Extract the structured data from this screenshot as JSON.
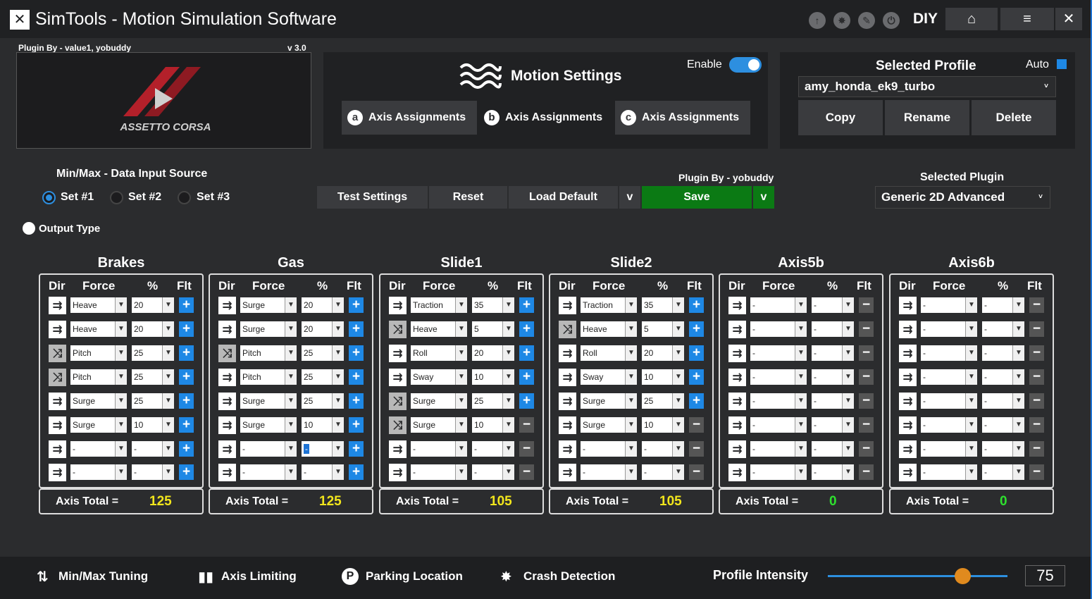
{
  "app": {
    "title": "SimTools - Motion Simulation Software",
    "diy": "DIY"
  },
  "plugin": {
    "by_top": "Plugin By - value1, yobuddy",
    "version": "v 3.0",
    "by_mid": "Plugin By - yobuddy"
  },
  "motion": {
    "title": "Motion Settings",
    "enable_label": "Enable",
    "enabled": true,
    "axis_buttons": [
      {
        "letter": "a",
        "label": "Axis Assignments"
      },
      {
        "letter": "b",
        "label": "Axis Assignments"
      },
      {
        "letter": "c",
        "label": "Axis Assignments"
      }
    ]
  },
  "profile": {
    "title": "Selected Profile",
    "auto_label": "Auto",
    "auto": true,
    "current": "amy_honda_ek9_turbo",
    "buttons": [
      "Copy",
      "Rename",
      "Delete"
    ]
  },
  "minmax": {
    "label": "Min/Max - Data Input Source",
    "sets": [
      "Set #1",
      "Set #2",
      "Set #3"
    ],
    "selected": 0
  },
  "output_type": "Output Type",
  "actions": {
    "test": "Test Settings",
    "reset": "Reset",
    "load_default": "Load Default",
    "dd": "v",
    "save": "Save"
  },
  "selected_plugin": {
    "label": "Selected Plugin",
    "value": "Generic 2D Advanced"
  },
  "headers": {
    "dir": "Dir",
    "force": "Force",
    "pct": "%",
    "flt": "Flt"
  },
  "total_label": "Axis Total =",
  "axes": [
    {
      "name": "Brakes",
      "total": "125",
      "total_color": "#f2e61c",
      "rows": [
        {
          "dir": "n",
          "force": "Heave",
          "pct": "20",
          "flt": "+"
        },
        {
          "dir": "n",
          "force": "Heave",
          "pct": "20",
          "flt": "+"
        },
        {
          "dir": "r",
          "force": "Pitch",
          "pct": "25",
          "flt": "+"
        },
        {
          "dir": "r",
          "force": "Pitch",
          "pct": "25",
          "flt": "+"
        },
        {
          "dir": "n",
          "force": "Surge",
          "pct": "25",
          "flt": "+"
        },
        {
          "dir": "n",
          "force": "Surge",
          "pct": "10",
          "flt": "+"
        },
        {
          "dir": "n",
          "force": "-",
          "pct": "-",
          "flt": "+"
        },
        {
          "dir": "n",
          "force": "-",
          "pct": "-",
          "flt": "+"
        }
      ]
    },
    {
      "name": "Gas",
      "total": "125",
      "total_color": "#f2e61c",
      "rows": [
        {
          "dir": "n",
          "force": "Surge",
          "pct": "20",
          "flt": "+"
        },
        {
          "dir": "n",
          "force": "Surge",
          "pct": "20",
          "flt": "+"
        },
        {
          "dir": "r",
          "force": "Pitch",
          "pct": "25",
          "flt": "+"
        },
        {
          "dir": "n",
          "force": "Pitch",
          "pct": "25",
          "flt": "+"
        },
        {
          "dir": "n",
          "force": "Surge",
          "pct": "25",
          "flt": "+"
        },
        {
          "dir": "n",
          "force": "Surge",
          "pct": "10",
          "flt": "+"
        },
        {
          "dir": "n",
          "force": "-",
          "pct": "-",
          "flt": "+",
          "hl": true
        },
        {
          "dir": "n",
          "force": "-",
          "pct": "-",
          "flt": "+"
        }
      ]
    },
    {
      "name": "Slide1",
      "total": "105",
      "total_color": "#f2e61c",
      "rows": [
        {
          "dir": "n",
          "force": "Traction",
          "pct": "35",
          "flt": "+"
        },
        {
          "dir": "r",
          "force": "Heave",
          "pct": "5",
          "flt": "+"
        },
        {
          "dir": "n",
          "force": "Roll",
          "pct": "20",
          "flt": "+"
        },
        {
          "dir": "n",
          "force": "Sway",
          "pct": "10",
          "flt": "+"
        },
        {
          "dir": "r",
          "force": "Surge",
          "pct": "25",
          "flt": "+"
        },
        {
          "dir": "r",
          "force": "Surge",
          "pct": "10",
          "flt": "-"
        },
        {
          "dir": "n",
          "force": "-",
          "pct": "-",
          "flt": "-"
        },
        {
          "dir": "n",
          "force": "-",
          "pct": "-",
          "flt": "-"
        }
      ]
    },
    {
      "name": "Slide2",
      "total": "105",
      "total_color": "#f2e61c",
      "rows": [
        {
          "dir": "n",
          "force": "Traction",
          "pct": "35",
          "flt": "+"
        },
        {
          "dir": "r",
          "force": "Heave",
          "pct": "5",
          "flt": "+"
        },
        {
          "dir": "n",
          "force": "Roll",
          "pct": "20",
          "flt": "+"
        },
        {
          "dir": "n",
          "force": "Sway",
          "pct": "10",
          "flt": "+"
        },
        {
          "dir": "n",
          "force": "Surge",
          "pct": "25",
          "flt": "+"
        },
        {
          "dir": "n",
          "force": "Surge",
          "pct": "10",
          "flt": "-"
        },
        {
          "dir": "n",
          "force": "-",
          "pct": "-",
          "flt": "-"
        },
        {
          "dir": "n",
          "force": "-",
          "pct": "-",
          "flt": "-"
        }
      ]
    },
    {
      "name": "Axis5b",
      "total": "0",
      "total_color": "#2ee02e",
      "rows": [
        {
          "dir": "n",
          "force": "-",
          "pct": "-",
          "flt": "-"
        },
        {
          "dir": "n",
          "force": "-",
          "pct": "-",
          "flt": "-"
        },
        {
          "dir": "n",
          "force": "-",
          "pct": "-",
          "flt": "-"
        },
        {
          "dir": "n",
          "force": "-",
          "pct": "-",
          "flt": "-"
        },
        {
          "dir": "n",
          "force": "-",
          "pct": "-",
          "flt": "-"
        },
        {
          "dir": "n",
          "force": "-",
          "pct": "-",
          "flt": "-"
        },
        {
          "dir": "n",
          "force": "-",
          "pct": "-",
          "flt": "-"
        },
        {
          "dir": "n",
          "force": "-",
          "pct": "-",
          "flt": "-"
        }
      ]
    },
    {
      "name": "Axis6b",
      "total": "0",
      "total_color": "#2ee02e",
      "rows": [
        {
          "dir": "n",
          "force": "-",
          "pct": "-",
          "flt": "-"
        },
        {
          "dir": "n",
          "force": "-",
          "pct": "-",
          "flt": "-"
        },
        {
          "dir": "n",
          "force": "-",
          "pct": "-",
          "flt": "-"
        },
        {
          "dir": "n",
          "force": "-",
          "pct": "-",
          "flt": "-"
        },
        {
          "dir": "n",
          "force": "-",
          "pct": "-",
          "flt": "-"
        },
        {
          "dir": "n",
          "force": "-",
          "pct": "-",
          "flt": "-"
        },
        {
          "dir": "n",
          "force": "-",
          "pct": "-",
          "flt": "-"
        },
        {
          "dir": "n",
          "force": "-",
          "pct": "-",
          "flt": "-"
        }
      ]
    }
  ],
  "bottom": {
    "minmax_tuning": "Min/Max Tuning",
    "axis_limiting": "Axis Limiting",
    "parking_location": "Parking Location",
    "crash_detection": "Crash Detection",
    "intensity_label": "Profile Intensity",
    "intensity": "75"
  }
}
